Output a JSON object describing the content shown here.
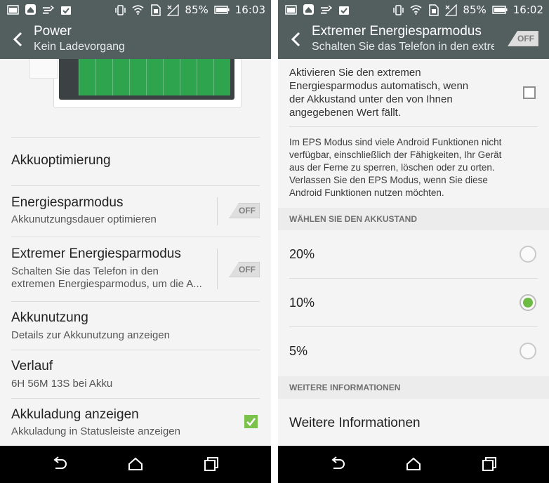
{
  "left": {
    "status": {
      "battery": "85%",
      "time": "16:03"
    },
    "header": {
      "title": "Power",
      "subtitle": "Kein Ladevorgang"
    },
    "rows": {
      "optimize": {
        "title": "Akkuoptimierung"
      },
      "saver": {
        "title": "Energiesparmodus",
        "subtitle": "Akkunutzungsdauer optimieren",
        "toggle": "OFF"
      },
      "extreme": {
        "title": "Extremer Energiesparmodus",
        "subtitle_1": "Schalten Sie das Telefon in den",
        "subtitle_2": "extremen Energiesparmodus, um die A...",
        "toggle": "OFF"
      },
      "usage": {
        "title": "Akkunutzung",
        "subtitle": "Details zur Akkunutzung anzeigen"
      },
      "history": {
        "title": "Verlauf",
        "subtitle": "6H 56M 13S bei Akku"
      },
      "show_level": {
        "title": "Akkuladung anzeigen",
        "subtitle": "Akkuladung in Statusleiste anzeigen",
        "checked": true
      }
    },
    "colors": {
      "bar": "#535e5f",
      "chart": "#2ea44f",
      "check": "#7bc24d"
    }
  },
  "right": {
    "status": {
      "battery": "85%",
      "time": "16:02"
    },
    "header": {
      "title": "Extremer Energiesparmodus",
      "subtitle": "Schalten Sie das Telefon in den extre",
      "toggle": "OFF"
    },
    "auto": {
      "line_1": "Aktivieren Sie den extremen",
      "line_2": "Energiesparmodus automatisch, wenn",
      "line_3": "der Akkustand unter den von Ihnen",
      "line_4": "angegebenen Wert fällt.",
      "checked": false
    },
    "info": {
      "line_1": "Im EPS Modus sind viele Android Funktionen nicht",
      "line_2": "verfügbar, einschließlich der Fähigkeiten, Ihr Gerät",
      "line_3": "aus der Ferne zu sperren, löschen oder zu orten.",
      "line_4": "Verlassen Sie den EPS Modus, wenn Sie diese",
      "line_5": "Android Funktionen nutzen möchten."
    },
    "section_level": "WÄHLEN SIE DEN AKKUSTAND",
    "levels": [
      {
        "label": "20%",
        "selected": false
      },
      {
        "label": "10%",
        "selected": true
      },
      {
        "label": "5%",
        "selected": false
      }
    ],
    "section_more": "WEITERE INFORMATIONEN",
    "more_link": "Weitere Informationen"
  }
}
